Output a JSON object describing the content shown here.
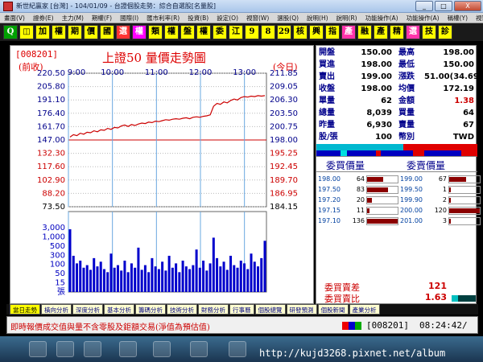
{
  "window": {
    "title": "新世紀贏家 [台灣] - 104/01/09 - 台證個股走勢：綜合自選股[名量股]",
    "buttons": [
      "_",
      "□",
      "X"
    ]
  },
  "menu": [
    "畫面(V)",
    "證券(E)",
    "主力(M)",
    "期權(F)",
    "國際(I)",
    "匯市利率(R)",
    "投資(B)",
    "設定(O)",
    "視窗(W)",
    "選股(Q)",
    "說明(H)",
    "說明(R)",
    "功能操作(A)",
    "功能操作(A)",
    "稱權(Y)",
    "視窗(W)"
  ],
  "toolbar": [
    {
      "t": "Q",
      "bg": "#00a000",
      "fg": "#fff"
    },
    {
      "t": "◫",
      "bg": "#ffff00",
      "fg": "#000"
    },
    {
      "t": "加",
      "bg": "#ffff00",
      "fg": "#000"
    },
    {
      "t": "權",
      "bg": "#ffff00",
      "fg": "#000"
    },
    {
      "t": "期",
      "bg": "#ffff00",
      "fg": "#000"
    },
    {
      "t": "價",
      "bg": "#ffff00",
      "fg": "#000"
    },
    {
      "t": "國",
      "bg": "#ffff00",
      "fg": "#000"
    },
    {
      "t": "選",
      "bg": "#ff3333",
      "fg": "#fff"
    },
    {
      "t": "權",
      "bg": "#ff00ff",
      "fg": "#fff"
    },
    {
      "t": "類",
      "bg": "#ffff00",
      "fg": "#000"
    },
    {
      "t": "權",
      "bg": "#ffff00",
      "fg": "#000"
    },
    {
      "t": "盤",
      "bg": "#ffff00",
      "fg": "#000"
    },
    {
      "t": "權",
      "bg": "#ffff00",
      "fg": "#000"
    },
    {
      "t": "委",
      "bg": "#ffff00",
      "fg": "#000"
    },
    {
      "t": "江",
      "bg": "#ffff00",
      "fg": "#000"
    },
    {
      "t": "9",
      "bg": "#ffff00",
      "fg": "#000"
    },
    {
      "t": "8",
      "bg": "#ffff00",
      "fg": "#000"
    },
    {
      "t": "29",
      "bg": "#ffff00",
      "fg": "#000"
    },
    {
      "t": "核",
      "bg": "#ffff00",
      "fg": "#000"
    },
    {
      "t": "興",
      "bg": "#ffff00",
      "fg": "#000"
    },
    {
      "t": "指",
      "bg": "#ffff00",
      "fg": "#000"
    },
    {
      "t": "產",
      "bg": "#ff33aa",
      "fg": "#fff"
    },
    {
      "t": "融",
      "bg": "#ffff00",
      "fg": "#000"
    },
    {
      "t": "產",
      "bg": "#ffff00",
      "fg": "#000"
    },
    {
      "t": "精",
      "bg": "#ffff00",
      "fg": "#000"
    },
    {
      "t": "選",
      "bg": "#ff33aa",
      "fg": "#fff"
    },
    {
      "t": "技",
      "bg": "#ffff00",
      "fg": "#000"
    },
    {
      "t": "診",
      "bg": "#ffff00",
      "fg": "#000"
    }
  ],
  "chart_header": {
    "code": "[008201]",
    "title": "上證50  量價走勢圖",
    "left_label": "(前收)",
    "right_label": "(今日)"
  },
  "chart_data": {
    "type": "line",
    "price_left_ticks": [
      "220.50",
      "205.80",
      "191.10",
      "176.40",
      "161.70",
      "147.00",
      "132.30",
      "117.60",
      "102.90",
      "88.20",
      "73.50"
    ],
    "price_right_ticks": [
      "211.85",
      "209.05",
      "206.30",
      "203.50",
      "200.75",
      "198.00",
      "195.25",
      "192.45",
      "189.70",
      "186.95",
      "184.15"
    ],
    "reference_price": 198.0,
    "price_range": [
      184.15,
      211.85
    ],
    "x_labels": [
      "9:00",
      "10:00",
      "11:00",
      "12:00",
      "13:00"
    ],
    "volume_ticks": [
      "3,000",
      "1,000",
      "500",
      "300",
      "100",
      "50",
      "15",
      "張"
    ],
    "price_line": [
      198.6,
      199.1,
      198.9,
      199.4,
      199.2,
      199.6,
      199.5,
      199.9,
      199.7,
      200.1,
      200.0,
      200.4,
      200.2,
      200.6,
      200.5,
      200.9,
      201.1,
      200.8,
      201.2,
      201.0,
      201.3,
      201.5,
      201.4,
      201.7,
      201.6,
      201.9,
      201.8,
      202.0,
      202.2,
      202.1,
      202.3,
      202.4,
      202.3,
      202.5,
      202.6,
      202.4,
      202.7,
      202.8,
      202.7,
      202.9,
      203.0,
      203.2,
      205.0,
      205.6,
      205.4,
      205.9,
      205.7,
      206.2,
      206.5,
      206.3,
      206.8,
      207.0,
      206.9,
      207.1,
      207.0,
      207.2,
      207.1,
      207.2
    ],
    "volume": [
      120,
      40,
      25,
      30,
      18,
      22,
      15,
      35,
      20,
      28,
      16,
      12,
      45,
      18,
      22,
      14,
      30,
      12,
      25,
      18,
      60,
      15,
      22,
      12,
      35,
      20,
      16,
      28,
      14,
      40,
      18,
      25,
      12,
      30,
      20,
      16,
      22,
      55,
      18,
      30,
      14,
      25,
      90,
      35,
      20,
      28,
      15,
      40,
      22,
      18,
      30,
      25,
      16,
      45,
      28,
      20,
      35,
      80
    ]
  },
  "quote": {
    "rows": [
      {
        "l1": "開盤",
        "v1": "150.00",
        "c1": "#000",
        "l2": "最高",
        "v2": "198.00",
        "c2": "#000"
      },
      {
        "l1": "買進",
        "v1": "198.00",
        "c1": "#000",
        "l2": "最低",
        "v2": "150.00",
        "c2": "#000"
      },
      {
        "l1": "賣出",
        "v1": "199.00",
        "c1": "#000",
        "l2": "漲跌",
        "v2": "51.00(34.69)",
        "c2": "#000"
      },
      {
        "l1": "收盤",
        "v1": "198.00",
        "c1": "#000",
        "l2": "均價",
        "v2": "172.19",
        "c2": "#000"
      },
      {
        "l1": "單量",
        "v1": "62",
        "c1": "#000",
        "l2": "金額",
        "v2": "1.38",
        "c2": "#c00"
      },
      {
        "l1": "總量",
        "v1": "8,039",
        "c1": "#000",
        "l2": "買量",
        "v2": "64",
        "c2": "#000"
      },
      {
        "l1": "昨量",
        "v1": "6,930",
        "c1": "#000",
        "l2": "賣量",
        "v2": "67",
        "c2": "#000"
      },
      {
        "l1": "股/張",
        "v1": "100",
        "c1": "#000",
        "l2": "幣別",
        "v2": "TWD",
        "c2": "#000"
      }
    ]
  },
  "book": {
    "bid_header": "委買價量",
    "ask_header": "委賣價量",
    "bids": [
      {
        "p": "198.00",
        "v": "64",
        "w": 0.53
      },
      {
        "p": "197.50",
        "v": "83",
        "w": 0.69
      },
      {
        "p": "197.20",
        "v": "20",
        "w": 0.17
      },
      {
        "p": "197.15",
        "v": "11",
        "w": 0.09
      },
      {
        "p": "197.10",
        "v": "136",
        "w": 1.0
      }
    ],
    "asks": [
      {
        "p": "199.00",
        "v": "67",
        "w": 0.56
      },
      {
        "p": "199.50",
        "v": "1",
        "w": 0.02
      },
      {
        "p": "199.90",
        "v": "2",
        "w": 0.03
      },
      {
        "p": "200.00",
        "v": "120",
        "w": 1.0
      },
      {
        "p": "201.00",
        "v": "3",
        "w": 0.04
      }
    ],
    "spread_label": "委買賣差",
    "spread_value": "121",
    "ratio_label": "委買賣比",
    "ratio_value": "1.63"
  },
  "tabs": [
    "當日走勢",
    "橫向分析",
    "深度分析",
    "基本分析",
    "籌碼分析",
    "技術分析",
    "財務分析",
    "行事曆",
    "個股總覽",
    "研發預測",
    "個股新聞",
    "產業分析"
  ],
  "status": {
    "message": "即時報價成交值與量不含零股及鉅額交易(淨值為預估值)",
    "code": "[008201]",
    "time": "08:24:42/"
  },
  "watermark": "http://kujd3268.pixnet.net/album"
}
